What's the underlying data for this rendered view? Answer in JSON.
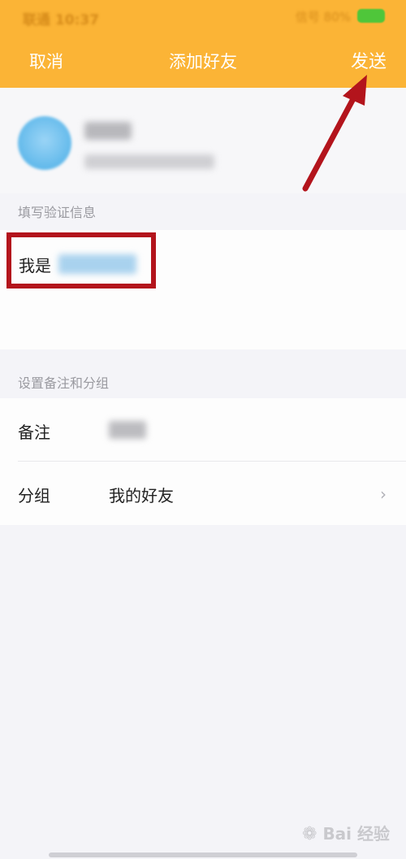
{
  "status_bar": {
    "carrier_time": "联通 10:37",
    "signal_text": "信号 80%",
    "battery_color": "#4fc63a"
  },
  "nav": {
    "cancel_label": "取消",
    "title": "添加好友",
    "send_label": "发送"
  },
  "colors": {
    "header_bg": "#fbb436",
    "annotation_red": "#b3141c",
    "page_bg": "#f4f4f8"
  },
  "profile": {
    "avatar_icon": "avatar-circle"
  },
  "verify_section": {
    "label": "填写验证信息",
    "message_prefix": "我是"
  },
  "remark_section": {
    "label": "设置备注和分组",
    "remark_label": "备注",
    "group_label": "分组",
    "group_value": "我的好友",
    "chevron_icon": "chevron-right-icon"
  },
  "watermark": {
    "text": "Bai 经验",
    "icon": "paw-icon"
  }
}
